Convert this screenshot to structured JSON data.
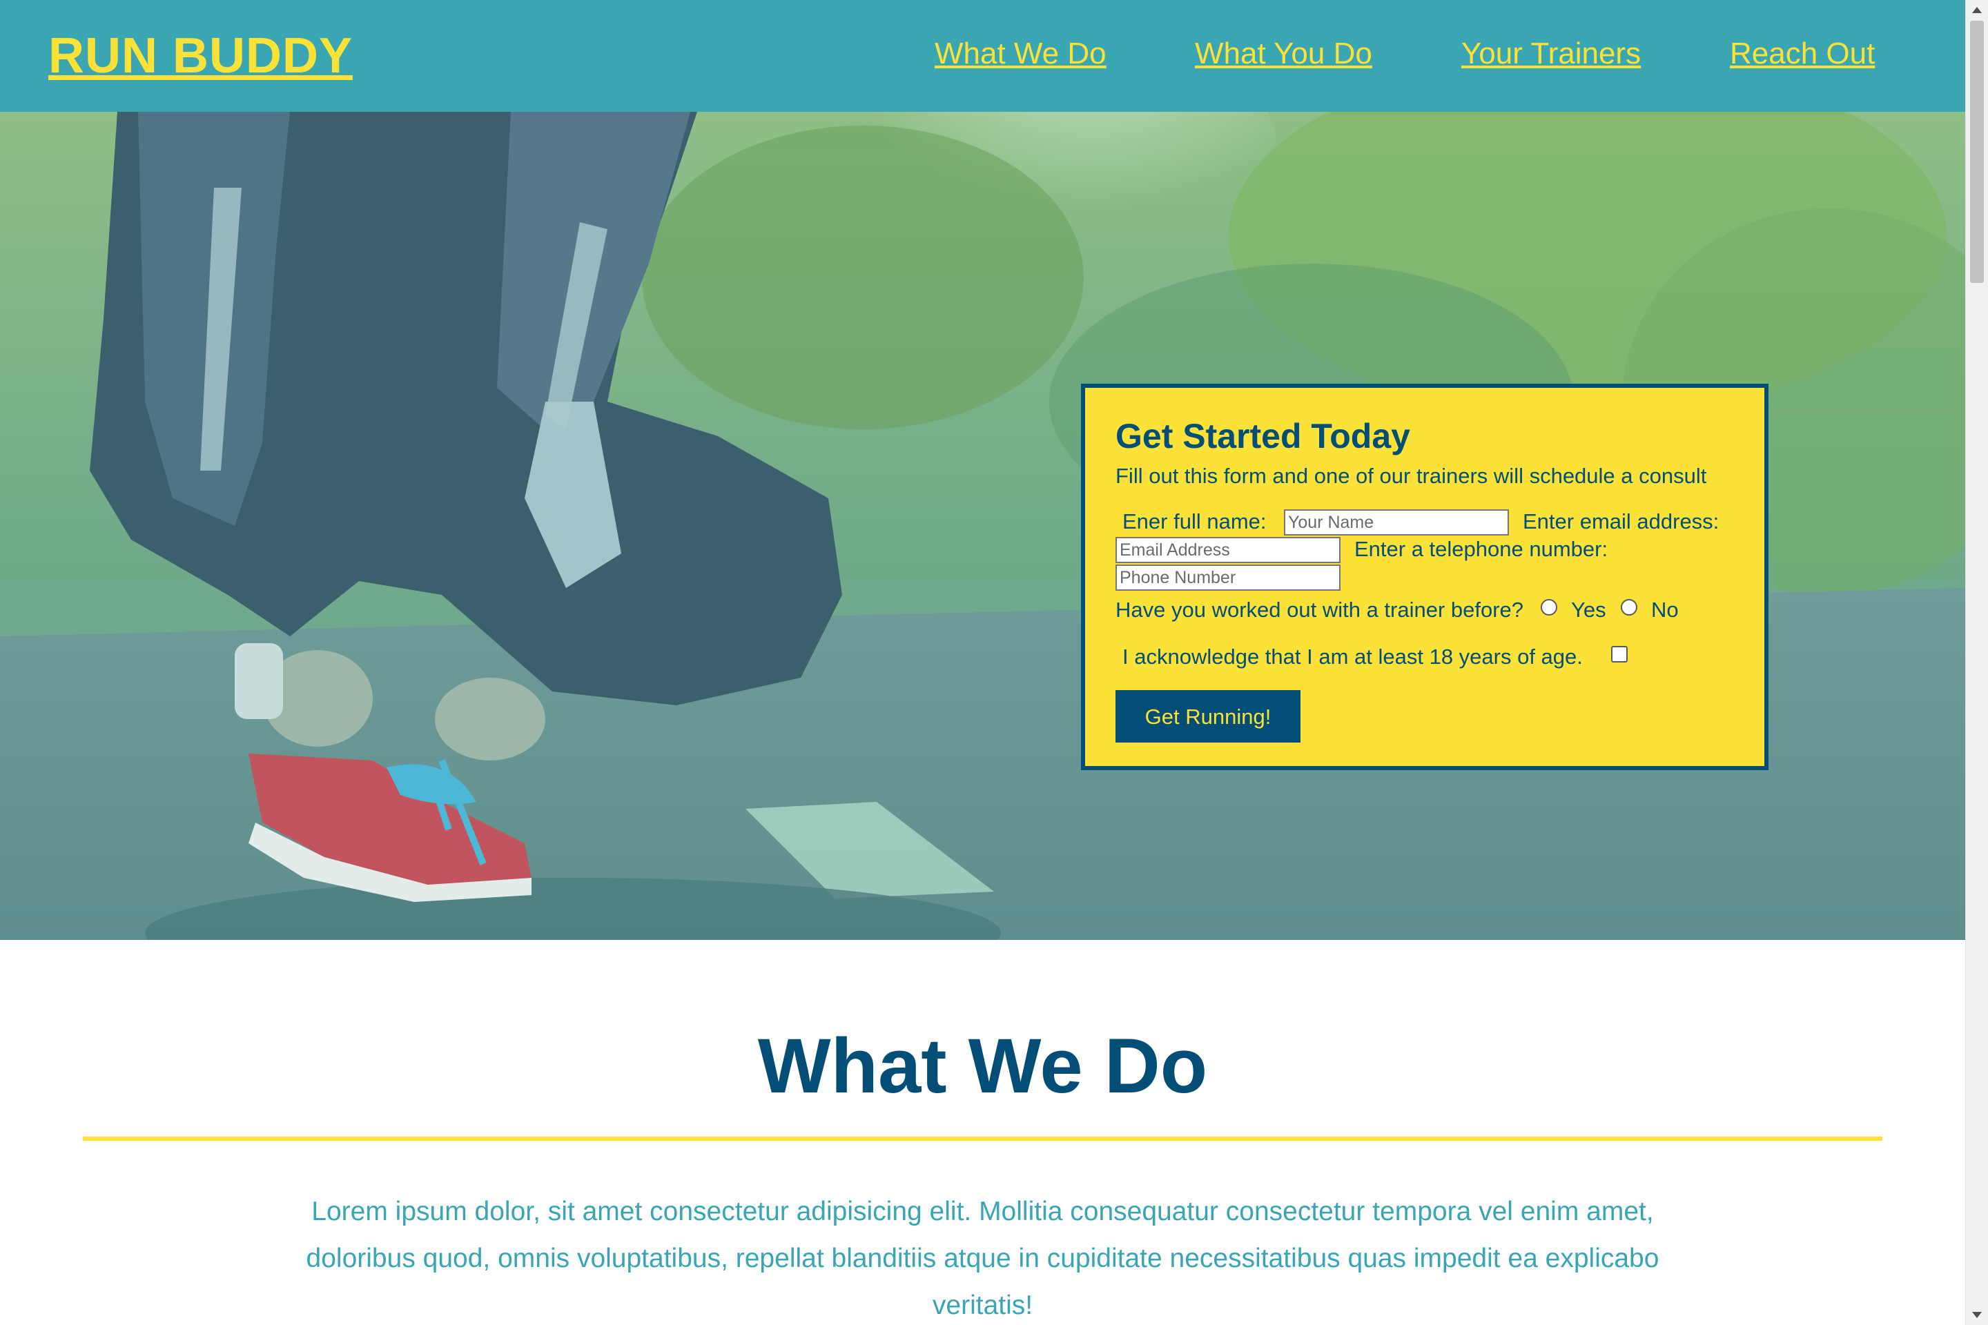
{
  "header": {
    "logo": "RUN BUDDY",
    "nav": [
      "What We Do",
      "What You Do",
      "Your Trainers",
      "Reach Out"
    ]
  },
  "hero": {
    "image_description": "person crouching on a tree-lined road tying red running shoe laces",
    "form": {
      "title": "Get Started Today",
      "subtitle": "Fill out this form and one of our trainers will schedule a consult",
      "name_label": "Ener full name:",
      "name_placeholder": "Your Name",
      "email_label": "Enter email address:",
      "email_placeholder": "Email Address",
      "phone_label": "Enter a telephone number:",
      "phone_placeholder": "Phone Number",
      "trainer_question": "Have you worked out with a trainer before?",
      "options": [
        "Yes",
        "No"
      ],
      "age_ack": "I acknowledge that I am at least 18 years of age.",
      "submit": "Get Running!"
    }
  },
  "what_we_do": {
    "title": "What We Do",
    "body": "Lorem ipsum dolor, sit amet consectetur adipisicing elit. Mollitia consequatur consectetur tempora vel enim amet, doloribus quod, omnis voluptatibus, repellat blanditiis atque in cupiditate necessitatibus quas impedit ea explicabo veritatis!"
  },
  "colors": {
    "teal": "#39a6b2",
    "yellow": "#fce138",
    "navy": "#024e76"
  }
}
